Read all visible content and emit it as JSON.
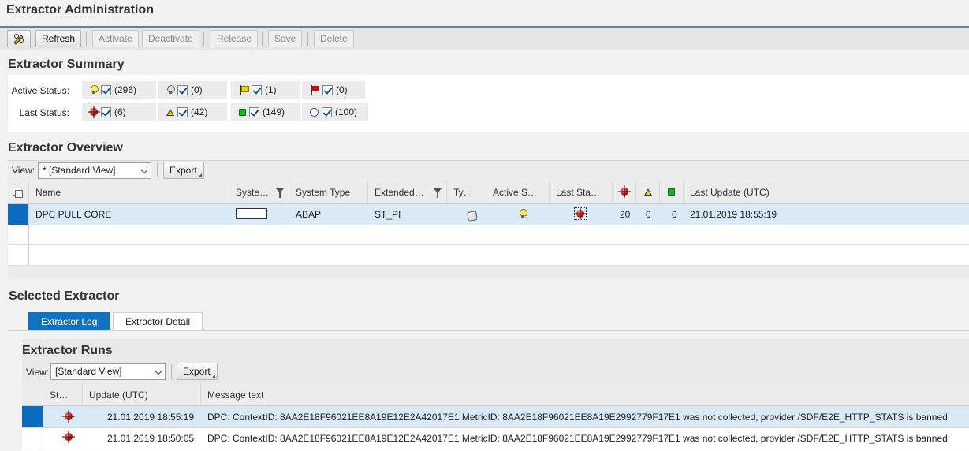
{
  "page": {
    "title": "Extractor Administration"
  },
  "toolbar": {
    "edit_icon": "pencil-glasses-icon",
    "buttons": [
      {
        "label": "Refresh",
        "enabled": true
      },
      {
        "label": "Activate",
        "enabled": false
      },
      {
        "label": "Deactivate",
        "enabled": false
      },
      {
        "label": "Release",
        "enabled": false
      },
      {
        "label": "Save",
        "enabled": false
      },
      {
        "label": "Delete",
        "enabled": false
      }
    ]
  },
  "summary": {
    "title": "Extractor Summary",
    "active_label": "Active Status:",
    "last_label": "Last Status:",
    "active": [
      {
        "icon": "lightbulb-on-icon",
        "checked": true,
        "count": "(296)"
      },
      {
        "icon": "lightbulb-off-icon",
        "checked": true,
        "count": "(0)"
      },
      {
        "icon": "yellow-flag-icon",
        "checked": true,
        "count": "(1)"
      },
      {
        "icon": "red-flag-icon",
        "checked": true,
        "count": "(0)"
      }
    ],
    "last": [
      {
        "icon": "red-light-icon",
        "checked": true,
        "count": "(6)"
      },
      {
        "icon": "yellow-triangle-icon",
        "checked": true,
        "count": "(42)"
      },
      {
        "icon": "green-square-icon",
        "checked": true,
        "count": "(149)"
      },
      {
        "icon": "empty-circle-icon",
        "checked": true,
        "count": "(100)"
      }
    ]
  },
  "overview": {
    "title": "Extractor Overview",
    "view_label": "View:",
    "view_value": "* [Standard View]",
    "export_label": "Export",
    "columns": [
      "Name",
      "Syste…",
      "System Type",
      "Extended…",
      "Ty…",
      "Active S…",
      "Last Sta…",
      "",
      "",
      "",
      "Last Update (UTC)"
    ],
    "header_icons": [
      "red-light-icon",
      "yellow-triangle-icon",
      "green-square-icon"
    ],
    "rows": [
      {
        "name": "DPC PULL CORE",
        "system": "",
        "system_type": "ABAP",
        "extended": "ST_PI",
        "type_icon": "extractor-type-icon",
        "active_icon": "lightbulb-on-icon",
        "last_icon": "red-light-icon",
        "red": "20",
        "yellow": "0",
        "green": "0",
        "last_update": "21.01.2019 18:55:19"
      }
    ]
  },
  "selected": {
    "title": "Selected Extractor",
    "tabs": [
      {
        "label": "Extractor Log",
        "active": true
      },
      {
        "label": "Extractor Detail",
        "active": false
      }
    ]
  },
  "runs": {
    "title": "Extractor Runs",
    "view_label": "View:",
    "view_value": "[Standard View]",
    "export_label": "Export",
    "columns": [
      "St…",
      "Update (UTC)",
      "Message text"
    ],
    "rows": [
      {
        "status_icon": "red-light-icon",
        "update": "21.01.2019 18:55:19",
        "message": "DPC: ContextID: 8AA2E18F96021EE8A19E12E2A42017E1 MetricID: 8AA2E18F96021EE8A19E2992779F17E1 was not collected, provider /SDF/E2E_HTTP_STATS is banned."
      },
      {
        "status_icon": "red-light-icon",
        "update": "21.01.2019 18:50:05",
        "message": "DPC: ContextID: 8AA2E18F96021EE8A19E12E2A42017E1 MetricID: 8AA2E18F96021EE8A19E2992779F17E1 was not collected, provider /SDF/E2E_HTTP_STATS is banned."
      }
    ]
  }
}
